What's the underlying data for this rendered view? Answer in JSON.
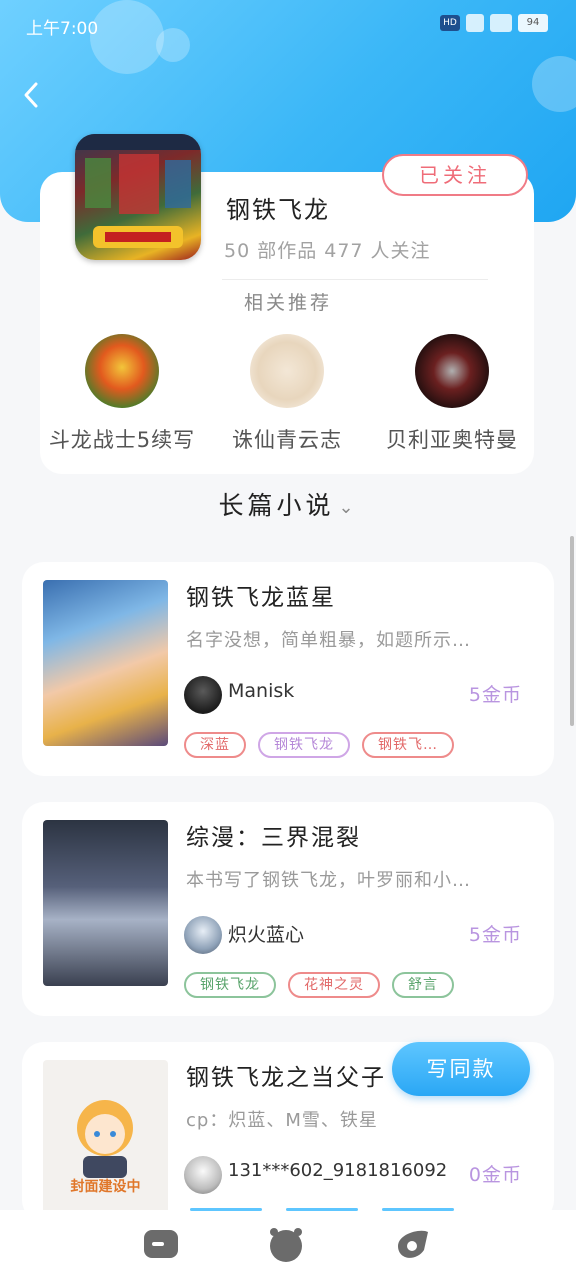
{
  "status_bar": {
    "time": "上午7:00",
    "hd": "HD",
    "battery": "94"
  },
  "author": {
    "name": "钢铁飞龙",
    "stats": "50 部作品   477 人关注",
    "follow_label": "已关注"
  },
  "recommend": {
    "title": "相关推荐",
    "items": [
      {
        "name": "斗龙战士5续写"
      },
      {
        "name": "诛仙青云志"
      },
      {
        "name": "贝利亚奥特曼"
      }
    ]
  },
  "category": {
    "label": "长篇小说",
    "chevron": "⌄"
  },
  "books": [
    {
      "title": "钢铁飞龙蓝星",
      "desc": "名字没想，简单粗暴，如题所示…",
      "author": "Manisk",
      "price": "5金币",
      "tags": [
        "深蓝",
        "钢铁飞龙",
        "钢铁飞…"
      ]
    },
    {
      "title": "综漫：三界混裂",
      "desc": "本书写了钢铁飞龙，叶罗丽和小…",
      "author": "炽火蓝心",
      "price": "5金币",
      "tags": [
        "钢铁飞龙",
        "花神之灵",
        "舒言"
      ]
    },
    {
      "title": "钢铁飞龙之当父子",
      "desc": "cp：炽蓝、M雪、铁星",
      "author": "131***602_9181816092",
      "price": "0金币",
      "cover_text": "封面建设中"
    }
  ],
  "write_button": "写同款",
  "colors": {
    "header_blue": "#3bb7f7",
    "follow_red": "#ef6c78",
    "price_purple": "#b995e0",
    "write_blue": "#2aa7f5"
  }
}
